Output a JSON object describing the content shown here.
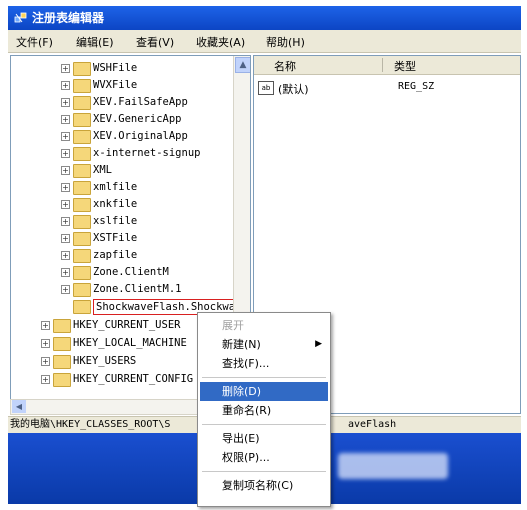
{
  "window": {
    "title": "注册表编辑器"
  },
  "menu": [
    "文件(F)",
    "编辑(E)",
    "查看(V)",
    "收藏夹(A)",
    "帮助(H)"
  ],
  "tree": {
    "items": [
      {
        "label": "WSHFile",
        "expand": "+"
      },
      {
        "label": "WVXFile",
        "expand": "+"
      },
      {
        "label": "XEV.FailSafeApp",
        "expand": "+"
      },
      {
        "label": "XEV.GenericApp",
        "expand": "+"
      },
      {
        "label": "XEV.OriginalApp",
        "expand": "+"
      },
      {
        "label": "x-internet-signup",
        "expand": "+"
      },
      {
        "label": "XML",
        "expand": "+"
      },
      {
        "label": "xmlfile",
        "expand": "+"
      },
      {
        "label": "xnkfile",
        "expand": "+"
      },
      {
        "label": "xslfile",
        "expand": "+"
      },
      {
        "label": "XSTFile",
        "expand": "+"
      },
      {
        "label": "zapfile",
        "expand": "+"
      },
      {
        "label": "Zone.ClientM",
        "expand": "+"
      },
      {
        "label": "Zone.ClientM.1",
        "expand": "+"
      },
      {
        "label": "ShockwaveFlash.ShockwaveFlash",
        "expand": ""
      },
      {
        "label": "HKEY_CURRENT_USER",
        "expand": "+"
      },
      {
        "label": "HKEY_LOCAL_MACHINE",
        "expand": "+"
      },
      {
        "label": "HKEY_USERS",
        "expand": "+"
      },
      {
        "label": "HKEY_CURRENT_CONFIG",
        "expand": "+"
      }
    ]
  },
  "list": {
    "columns": [
      "名称",
      "类型"
    ],
    "rows": [
      {
        "name": "(默认)",
        "type": "REG_SZ",
        "icon": "ab"
      }
    ]
  },
  "context_menu": {
    "items": [
      {
        "label": "展开",
        "disabled": true
      },
      {
        "label": "新建(N)",
        "submenu": true
      },
      {
        "label": "查找(F)..."
      },
      {
        "label": "删除(D)",
        "highlighted": true
      },
      {
        "label": "重命名(R)"
      },
      {
        "label": "导出(E)"
      },
      {
        "label": "权限(P)..."
      },
      {
        "label": "复制项名称(C)"
      }
    ]
  },
  "status": {
    "path": "我的电脑\\HKEY_CLASSES_ROOT\\S",
    "path_tail": "aveFlash"
  },
  "colors": {
    "highlight": "#316ac5",
    "selection_border": "#d82020",
    "titlebar": "#0c45c4"
  }
}
